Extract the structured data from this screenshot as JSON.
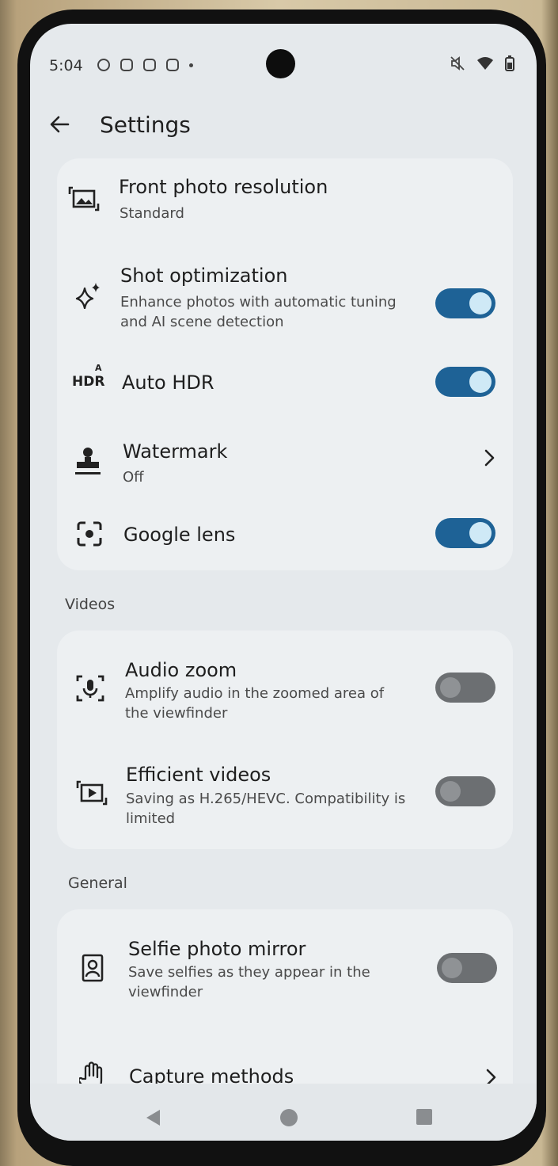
{
  "status_bar": {
    "time": "5:04"
  },
  "header": {
    "title": "Settings"
  },
  "photo_settings": [
    {
      "title": "Front photo resolution",
      "subtitle": "Standard",
      "icon": "photo-resolution-icon",
      "control": "none"
    },
    {
      "title": "Shot optimization",
      "subtitle_lines": [
        "Enhance photos with automatic tuning",
        "and AI scene detection"
      ],
      "icon": "sparkle-icon",
      "control": "switch",
      "checked": true
    },
    {
      "title": "Auto HDR",
      "icon_text": "HDR",
      "icon_badge": "A",
      "icon": "hdr-auto-icon",
      "control": "switch",
      "checked": true
    },
    {
      "title": "Watermark",
      "subtitle": "Off",
      "icon": "stamp-icon",
      "control": "chevron"
    },
    {
      "title": "Google lens",
      "icon": "lens-icon",
      "control": "switch",
      "checked": true
    }
  ],
  "videos_section": {
    "label": "Videos"
  },
  "video_settings": [
    {
      "title": "Audio zoom",
      "subtitle_lines": [
        "Amplify audio in the zoomed area of",
        "the viewfinder"
      ],
      "icon": "audio-zoom-icon",
      "control": "switch",
      "checked": false
    },
    {
      "title": "Efficient videos",
      "subtitle_lines": [
        "Saving as H.265/HEVC. Compatibility is",
        "limited"
      ],
      "icon": "video-file-icon",
      "control": "switch",
      "checked": false
    }
  ],
  "general_section": {
    "label": "General"
  },
  "general_settings": [
    {
      "title": "Selfie photo mirror",
      "subtitle_lines": [
        "Save selfies as they appear in the",
        "viewfinder"
      ],
      "icon": "selfie-portrait-icon",
      "control": "switch",
      "checked": false
    },
    {
      "title": "Capture methods",
      "icon": "hand-gesture-icon",
      "control": "chevron"
    }
  ],
  "colors": {
    "switch_on": "#1e6296",
    "switch_on_thumb": "#cfe9f6",
    "switch_off": "#6c6f72",
    "screen_bg": "#e5e9ec",
    "card_bg": "#edf0f2"
  }
}
